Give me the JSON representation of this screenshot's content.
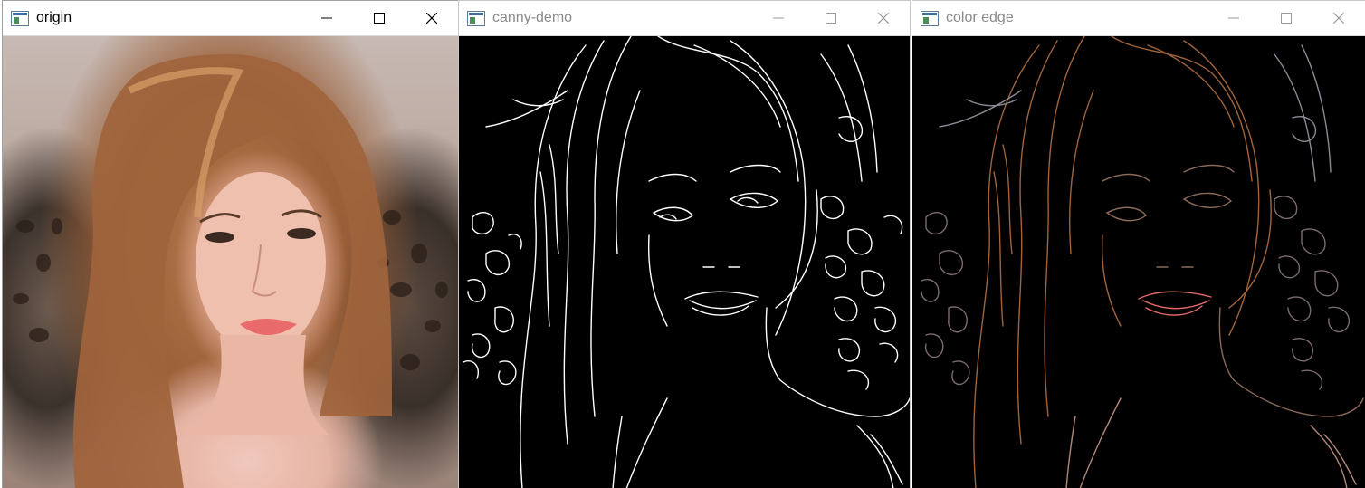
{
  "windows": [
    {
      "id": "origin",
      "title": "origin",
      "active": true
    },
    {
      "id": "canny",
      "title": "canny-demo",
      "active": false
    },
    {
      "id": "color",
      "title": "color edge",
      "active": false
    }
  ],
  "controls": {
    "minimize": "minimize-icon",
    "maximize": "maximize-icon",
    "close": "close-icon"
  },
  "colors": {
    "titlebar": "#ffffff",
    "edge_white": "#ffffff",
    "edge_bg": "#000000",
    "hair_brown": "#a0643c",
    "lip_red": "#e86a6a"
  }
}
